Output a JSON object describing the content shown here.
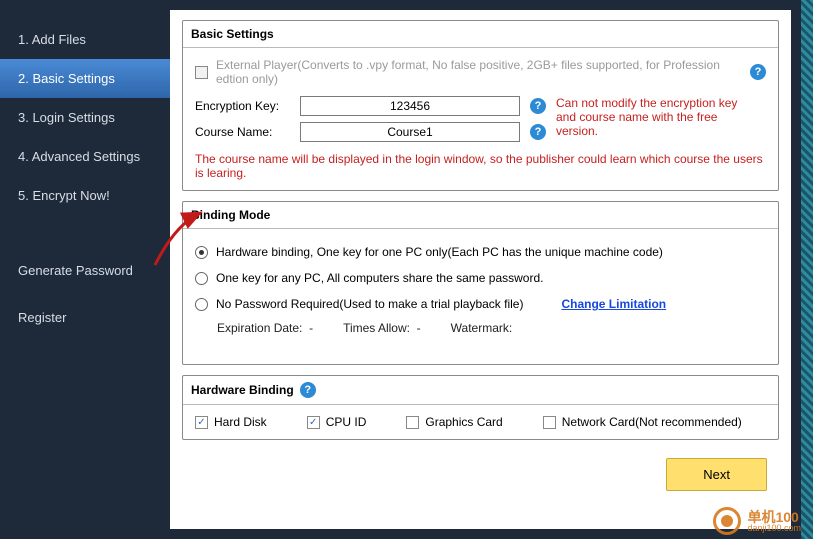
{
  "sidebar": {
    "items": [
      {
        "label": "1. Add Files"
      },
      {
        "label": "2. Basic Settings"
      },
      {
        "label": "3. Login Settings"
      },
      {
        "label": "4. Advanced Settings"
      },
      {
        "label": "5. Encrypt Now!"
      }
    ],
    "links": [
      {
        "label": "Generate Password"
      },
      {
        "label": "Register"
      }
    ]
  },
  "basicSettings": {
    "title": "Basic Settings",
    "external_label": "External Player(Converts to .vpy format, No false positive, 2GB+ files supported, for Profession edtion only)",
    "enc_key_label": "Encryption Key:",
    "enc_key_value": "123456",
    "enc_key_warn": "Can not modify the encryption key and course name with the free version.",
    "course_label": "Course Name:",
    "course_value": "Course1",
    "course_note": "The course name will be displayed in the login window, so the publisher could learn which course the users is learing."
  },
  "bindingMode": {
    "title": "Binding Mode",
    "opt_hw": "Hardware binding, One key for one PC only(Each PC has the unique machine code)",
    "opt_any": "One key for any PC, All computers share the same password.",
    "opt_none": "No Password Required(Used to make a trial playback file)",
    "change_link": "Change Limitation",
    "exp_label": "Expiration Date:",
    "exp_value": "-",
    "times_label": "Times Allow:",
    "times_value": "-",
    "wm_label": "Watermark:",
    "wm_value": ""
  },
  "hardwareBinding": {
    "title": "Hardware Binding",
    "items": [
      {
        "label": "Hard Disk",
        "checked": true
      },
      {
        "label": "CPU ID",
        "checked": true
      },
      {
        "label": "Graphics Card",
        "checked": false
      },
      {
        "label": "Network Card(Not recommended)",
        "checked": false
      }
    ]
  },
  "buttons": {
    "next": "Next"
  },
  "watermark": {
    "main": "单机100",
    "sub": "danji100.com"
  }
}
